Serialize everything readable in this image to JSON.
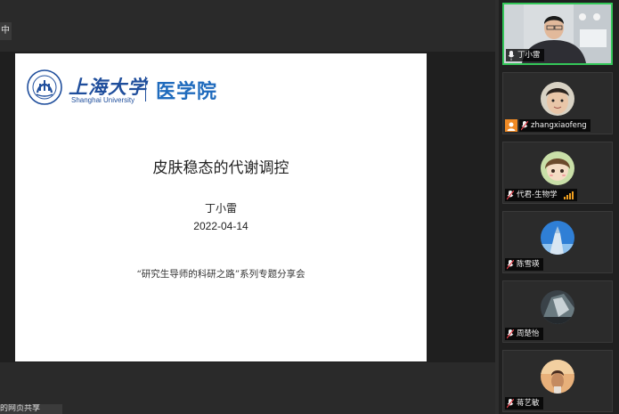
{
  "main": {
    "sharer_tab": "中",
    "bottom_caption": "的网页共享"
  },
  "slide": {
    "logo": {
      "name_cn": "上海大学",
      "name_en": "Shanghai University",
      "department": "医学院",
      "brand_color": "#1f4e9c"
    },
    "title": "皮肤稳态的代谢调控",
    "author": "丁小雷",
    "date": "2022-04-14",
    "subtitle": "“研究生导师的科研之路”系列专题分享会"
  },
  "participants": [
    {
      "name": "丁小雷",
      "mic": "on",
      "kind": "video",
      "active": true
    },
    {
      "name": "zhangxiaofeng",
      "mic": "muted",
      "kind": "avatar",
      "host": true
    },
    {
      "name": "代君-生物学",
      "mic": "muted",
      "kind": "avatar",
      "signal": true
    },
    {
      "name": "陈雪瑛",
      "mic": "muted",
      "kind": "avatar"
    },
    {
      "name": "周楚怡",
      "mic": "muted",
      "kind": "avatar"
    },
    {
      "name": "蒋艺敏",
      "mic": "muted",
      "kind": "avatar"
    }
  ],
  "colors": {
    "active_border": "#34c759",
    "muted_mic": "#e0404a",
    "host_badge": "#f08a24"
  }
}
